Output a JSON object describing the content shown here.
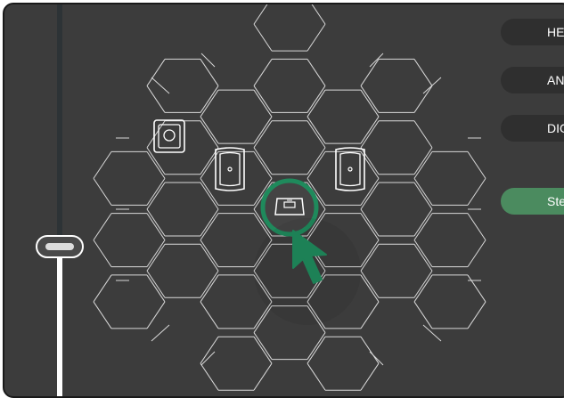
{
  "modes": [
    {
      "label": "HEADPHONES",
      "active": false
    },
    {
      "label": "ANALOG",
      "active": false
    },
    {
      "label": "DIGITAL",
      "active": false
    },
    {
      "label": "Stereo",
      "active": true
    }
  ],
  "colors": {
    "panel": "#3c3c3c",
    "grid_line": "#d9d9d9",
    "accent": "#1f8a5c",
    "active_button": "#4b8b5f",
    "button": "#2f2f2f"
  },
  "icons": {
    "speaker_left": "studio-monitor-icon",
    "speaker_right": "studio-monitor-icon",
    "speaker_tl": "small-speaker-icon",
    "speaker_center": "center-speaker-icon",
    "cursor": "pointer-arrow-icon"
  }
}
